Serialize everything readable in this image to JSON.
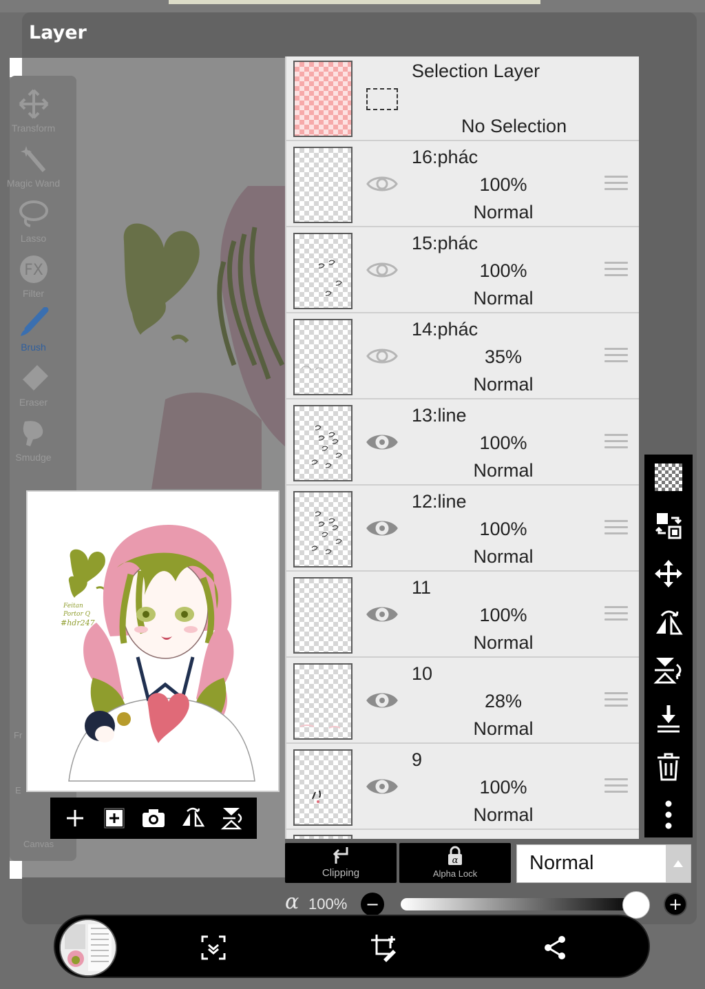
{
  "dialog": {
    "title": "Layer"
  },
  "tools": [
    {
      "label": "Transform",
      "icon": "move-cross-icon"
    },
    {
      "label": "Magic Wand",
      "icon": "magic-wand-icon"
    },
    {
      "label": "Lasso",
      "icon": "lasso-icon"
    },
    {
      "label": "Filter",
      "icon": "fx-icon"
    },
    {
      "label": "Brush",
      "icon": "brush-icon"
    },
    {
      "label": "Eraser",
      "icon": "eraser-icon"
    },
    {
      "label": "Smudge",
      "icon": "smudge-icon"
    }
  ],
  "hidden_tool_labels": [
    "Fr",
    "E",
    "Canvas"
  ],
  "artwork_signature": [
    "Feitan",
    "Portor Q",
    "#hdr247"
  ],
  "selection_layer": {
    "name": "Selection Layer",
    "status": "No Selection"
  },
  "layers": [
    {
      "name": "16:phác",
      "opacity": "100%",
      "blend": "Normal",
      "visible": false
    },
    {
      "name": "15:phác",
      "opacity": "100%",
      "blend": "Normal",
      "visible": false
    },
    {
      "name": "14:phác",
      "opacity": "35%",
      "blend": "Normal",
      "visible": false
    },
    {
      "name": "13:line",
      "opacity": "100%",
      "blend": "Normal",
      "visible": true
    },
    {
      "name": "12:line",
      "opacity": "100%",
      "blend": "Normal",
      "visible": true
    },
    {
      "name": "11",
      "opacity": "100%",
      "blend": "Normal",
      "visible": true
    },
    {
      "name": "10",
      "opacity": "28%",
      "blend": "Normal",
      "visible": true
    },
    {
      "name": "9",
      "opacity": "100%",
      "blend": "Normal",
      "visible": true
    }
  ],
  "right_toolbar": [
    "transparency-checker-icon",
    "swap-layers-icon",
    "move-layer-icon",
    "flip-horizontal-icon",
    "flip-vertical-icon",
    "merge-down-icon",
    "trash-icon",
    "more-vertical-icon"
  ],
  "preview_actions": [
    "add-layer-icon",
    "add-copy-icon",
    "camera-icon",
    "flip-h-icon",
    "flip-v-icon"
  ],
  "bottom_controls": {
    "clipping_label": "Clipping",
    "alpha_lock_label": "Alpha Lock",
    "blend_mode": "Normal",
    "alpha_symbol": "α",
    "opacity_value": "100%",
    "opacity_level": 1.0,
    "minus": "−",
    "plus": "+"
  },
  "bottom_bar": [
    "layers-thumbnail",
    "scan-select-icon",
    "crop-edit-icon",
    "share-icon"
  ],
  "colors": {
    "accent_blue": "#3a7bd5",
    "panel": "#ececec",
    "pink_check": "#f6a9a9",
    "hair_green": "#8f9d2d",
    "hair_pink": "#e99aae"
  }
}
